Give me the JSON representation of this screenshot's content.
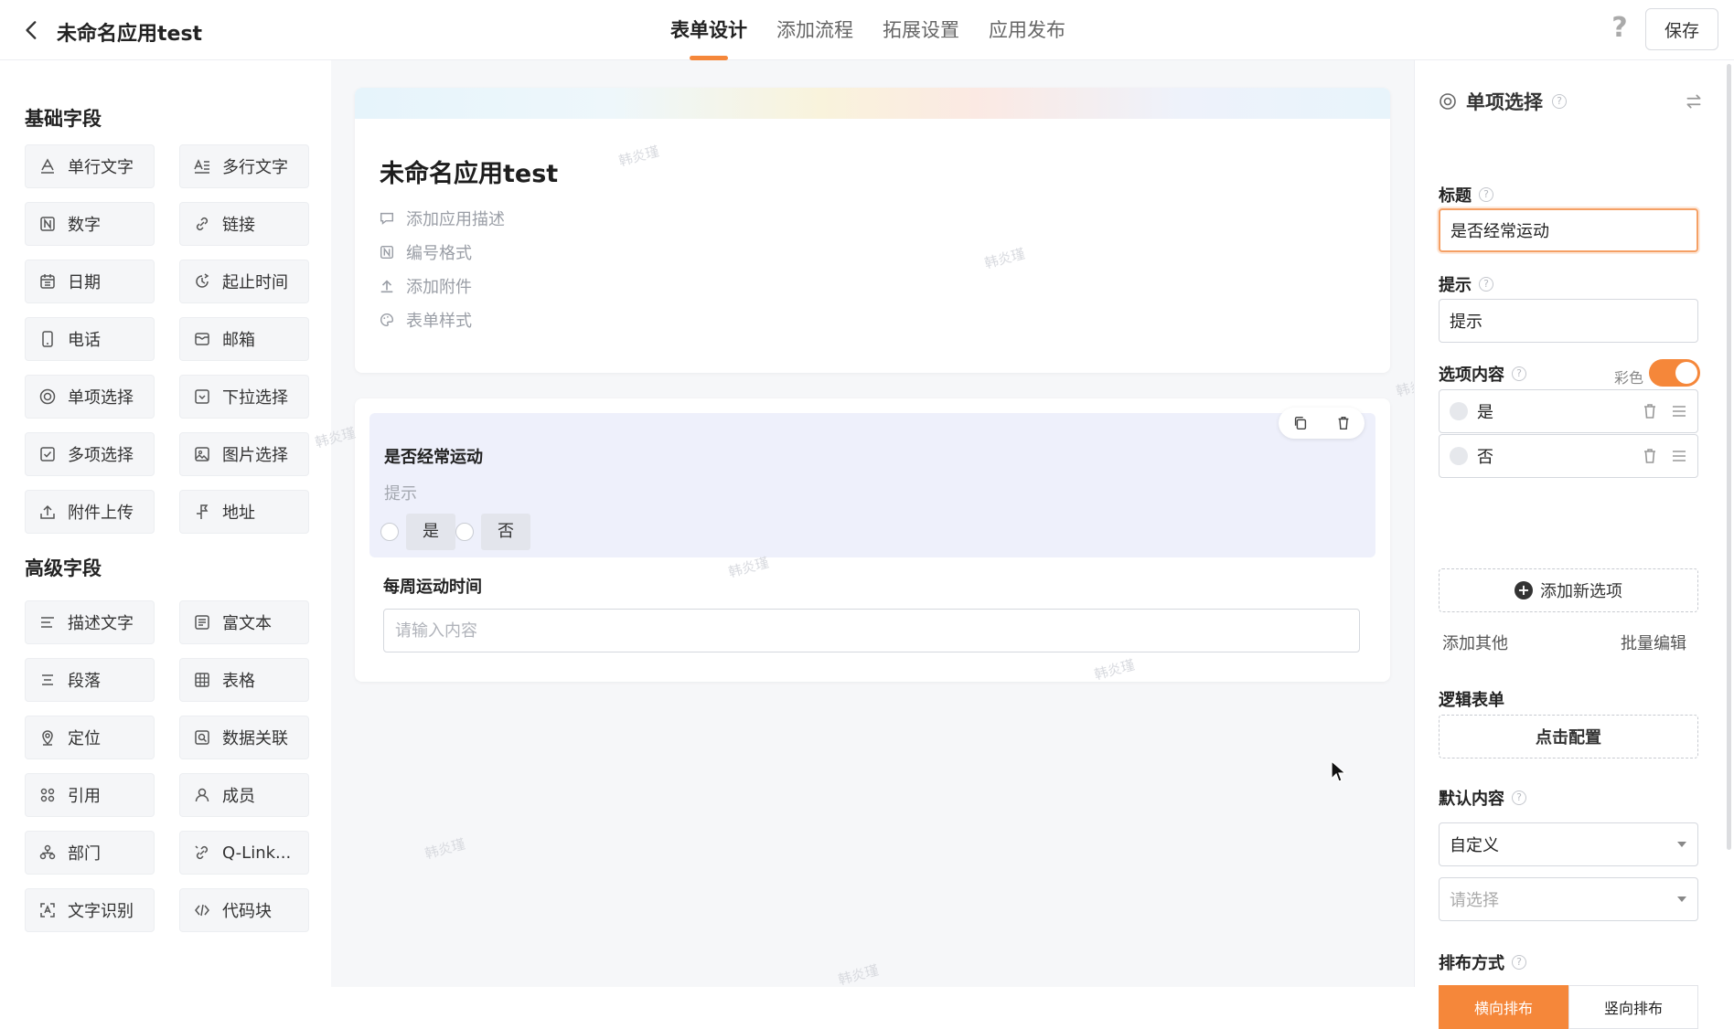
{
  "header": {
    "app_title": "未命名应用test",
    "tabs": [
      {
        "label": "表单设计",
        "active": true
      },
      {
        "label": "添加流程",
        "active": false
      },
      {
        "label": "拓展设置",
        "active": false
      },
      {
        "label": "应用发布",
        "active": false
      }
    ],
    "help_glyph": "?",
    "save_label": "保存"
  },
  "colors": {
    "accent": "#f5873a"
  },
  "left_panel": {
    "basic_title": "基础字段",
    "basic_fields": [
      {
        "label": "单行文字",
        "icon": "text-line-icon"
      },
      {
        "label": "多行文字",
        "icon": "text-multiline-icon"
      },
      {
        "label": "数字",
        "icon": "number-icon"
      },
      {
        "label": "链接",
        "icon": "link-icon"
      },
      {
        "label": "日期",
        "icon": "calendar-icon"
      },
      {
        "label": "起止时间",
        "icon": "time-range-icon"
      },
      {
        "label": "电话",
        "icon": "phone-icon"
      },
      {
        "label": "邮箱",
        "icon": "mail-icon"
      },
      {
        "label": "单项选择",
        "icon": "radio-icon"
      },
      {
        "label": "下拉选择",
        "icon": "dropdown-icon"
      },
      {
        "label": "多项选择",
        "icon": "checkbox-icon"
      },
      {
        "label": "图片选择",
        "icon": "image-icon"
      },
      {
        "label": "附件上传",
        "icon": "upload-icon"
      },
      {
        "label": "地址",
        "icon": "address-icon"
      }
    ],
    "advanced_title": "高级字段",
    "advanced_fields": [
      {
        "label": "描述文字",
        "icon": "description-icon"
      },
      {
        "label": "富文本",
        "icon": "rich-text-icon"
      },
      {
        "label": "段落",
        "icon": "paragraph-icon"
      },
      {
        "label": "表格",
        "icon": "table-icon"
      },
      {
        "label": "定位",
        "icon": "location-icon"
      },
      {
        "label": "数据关联",
        "icon": "data-link-icon"
      },
      {
        "label": "引用",
        "icon": "reference-icon"
      },
      {
        "label": "成员",
        "icon": "member-icon"
      },
      {
        "label": "部门",
        "icon": "department-icon"
      },
      {
        "label": "Q-Link...",
        "icon": "qlink-icon"
      },
      {
        "label": "文字识别",
        "icon": "ocr-icon"
      },
      {
        "label": "代码块",
        "icon": "code-icon"
      }
    ]
  },
  "canvas": {
    "form_title": "未命名应用test",
    "meta": [
      {
        "label": "添加应用描述",
        "icon": "comment-icon"
      },
      {
        "label": "编号格式",
        "icon": "number-format-icon"
      },
      {
        "label": "添加附件",
        "icon": "attachment-upload-icon"
      },
      {
        "label": "表单样式",
        "icon": "palette-icon"
      }
    ],
    "field1": {
      "label": "是否经常运动",
      "hint": "提示",
      "options": [
        "是",
        "否"
      ]
    },
    "field2": {
      "label": "每周运动时间",
      "placeholder": "请输入内容"
    },
    "watermark": "韩炎瑾"
  },
  "right_panel": {
    "title": "单项选择",
    "title_label": "标题",
    "title_value": "是否经常运动",
    "hint_label": "提示",
    "hint_value": "提示",
    "options_label": "选项内容",
    "color_label": "彩色",
    "color_on": true,
    "options": [
      "是",
      "否"
    ],
    "add_option": "添加新选项",
    "add_other": "添加其他",
    "batch_edit": "批量编辑",
    "logic_label": "逻辑表单",
    "logic_button": "点击配置",
    "default_label": "默认内容",
    "default_mode": "自定义",
    "default_select_placeholder": "请选择",
    "layout_label": "排布方式",
    "layout_options": [
      {
        "label": "横向排布",
        "active": true
      },
      {
        "label": "竖向排布",
        "active": false
      }
    ]
  }
}
